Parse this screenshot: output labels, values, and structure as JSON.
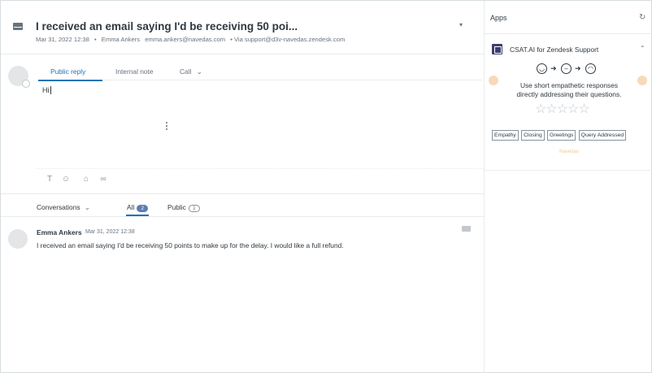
{
  "ticket": {
    "subject": "I received an email saying I'd be receiving 50 poi...",
    "menu_icon": "caret-down-icon",
    "meta": {
      "datetime": "Mar 31, 2022 12:38",
      "separator": "•",
      "requester": "Emma Ankers",
      "email": "emma.ankers@navedas.com",
      "via": "• Via support@d3v-navedas.zendesk.com"
    }
  },
  "composer": {
    "tabs": [
      "Public reply",
      "Internal note",
      "Call"
    ],
    "call_caret": "⌄",
    "text": "Hi",
    "tools": [
      "text-format-icon",
      "emoji-icon",
      "attachment-icon",
      "link-icon"
    ]
  },
  "conversations": {
    "label": "Conversations",
    "caret": "⌄",
    "filters": [
      {
        "label": "All",
        "count": "2"
      },
      {
        "label": "Public",
        "count": "1"
      }
    ]
  },
  "message": {
    "author": "Emma Ankers",
    "time": "Mar 31, 2022 12:38",
    "body": "I received an email saying I'd be receiving 50 points to make up for the delay.  I would like a full refund."
  },
  "apps": {
    "title": "Apps",
    "refresh_icon": "refresh-icon",
    "app": {
      "name": "CSAT.AI for Zendesk Support",
      "collapse_icon": "chevron-up-icon",
      "faces": [
        "happy-face-icon",
        "neutral-face-icon",
        "sad-face-icon"
      ],
      "tip_line1": "Use short empathetic responses",
      "tip_line2": "directly addressing their questions.",
      "stars": 5,
      "tags": [
        "Empathy",
        "Closing",
        "Greetings",
        "Query Addressed"
      ],
      "brand": "Navedas"
    }
  },
  "colors": {
    "accent": "#1f73b7",
    "text": "#2f3941",
    "muted": "#68737d",
    "badge": "#5a7db2",
    "peach": "#f8d9b8"
  }
}
